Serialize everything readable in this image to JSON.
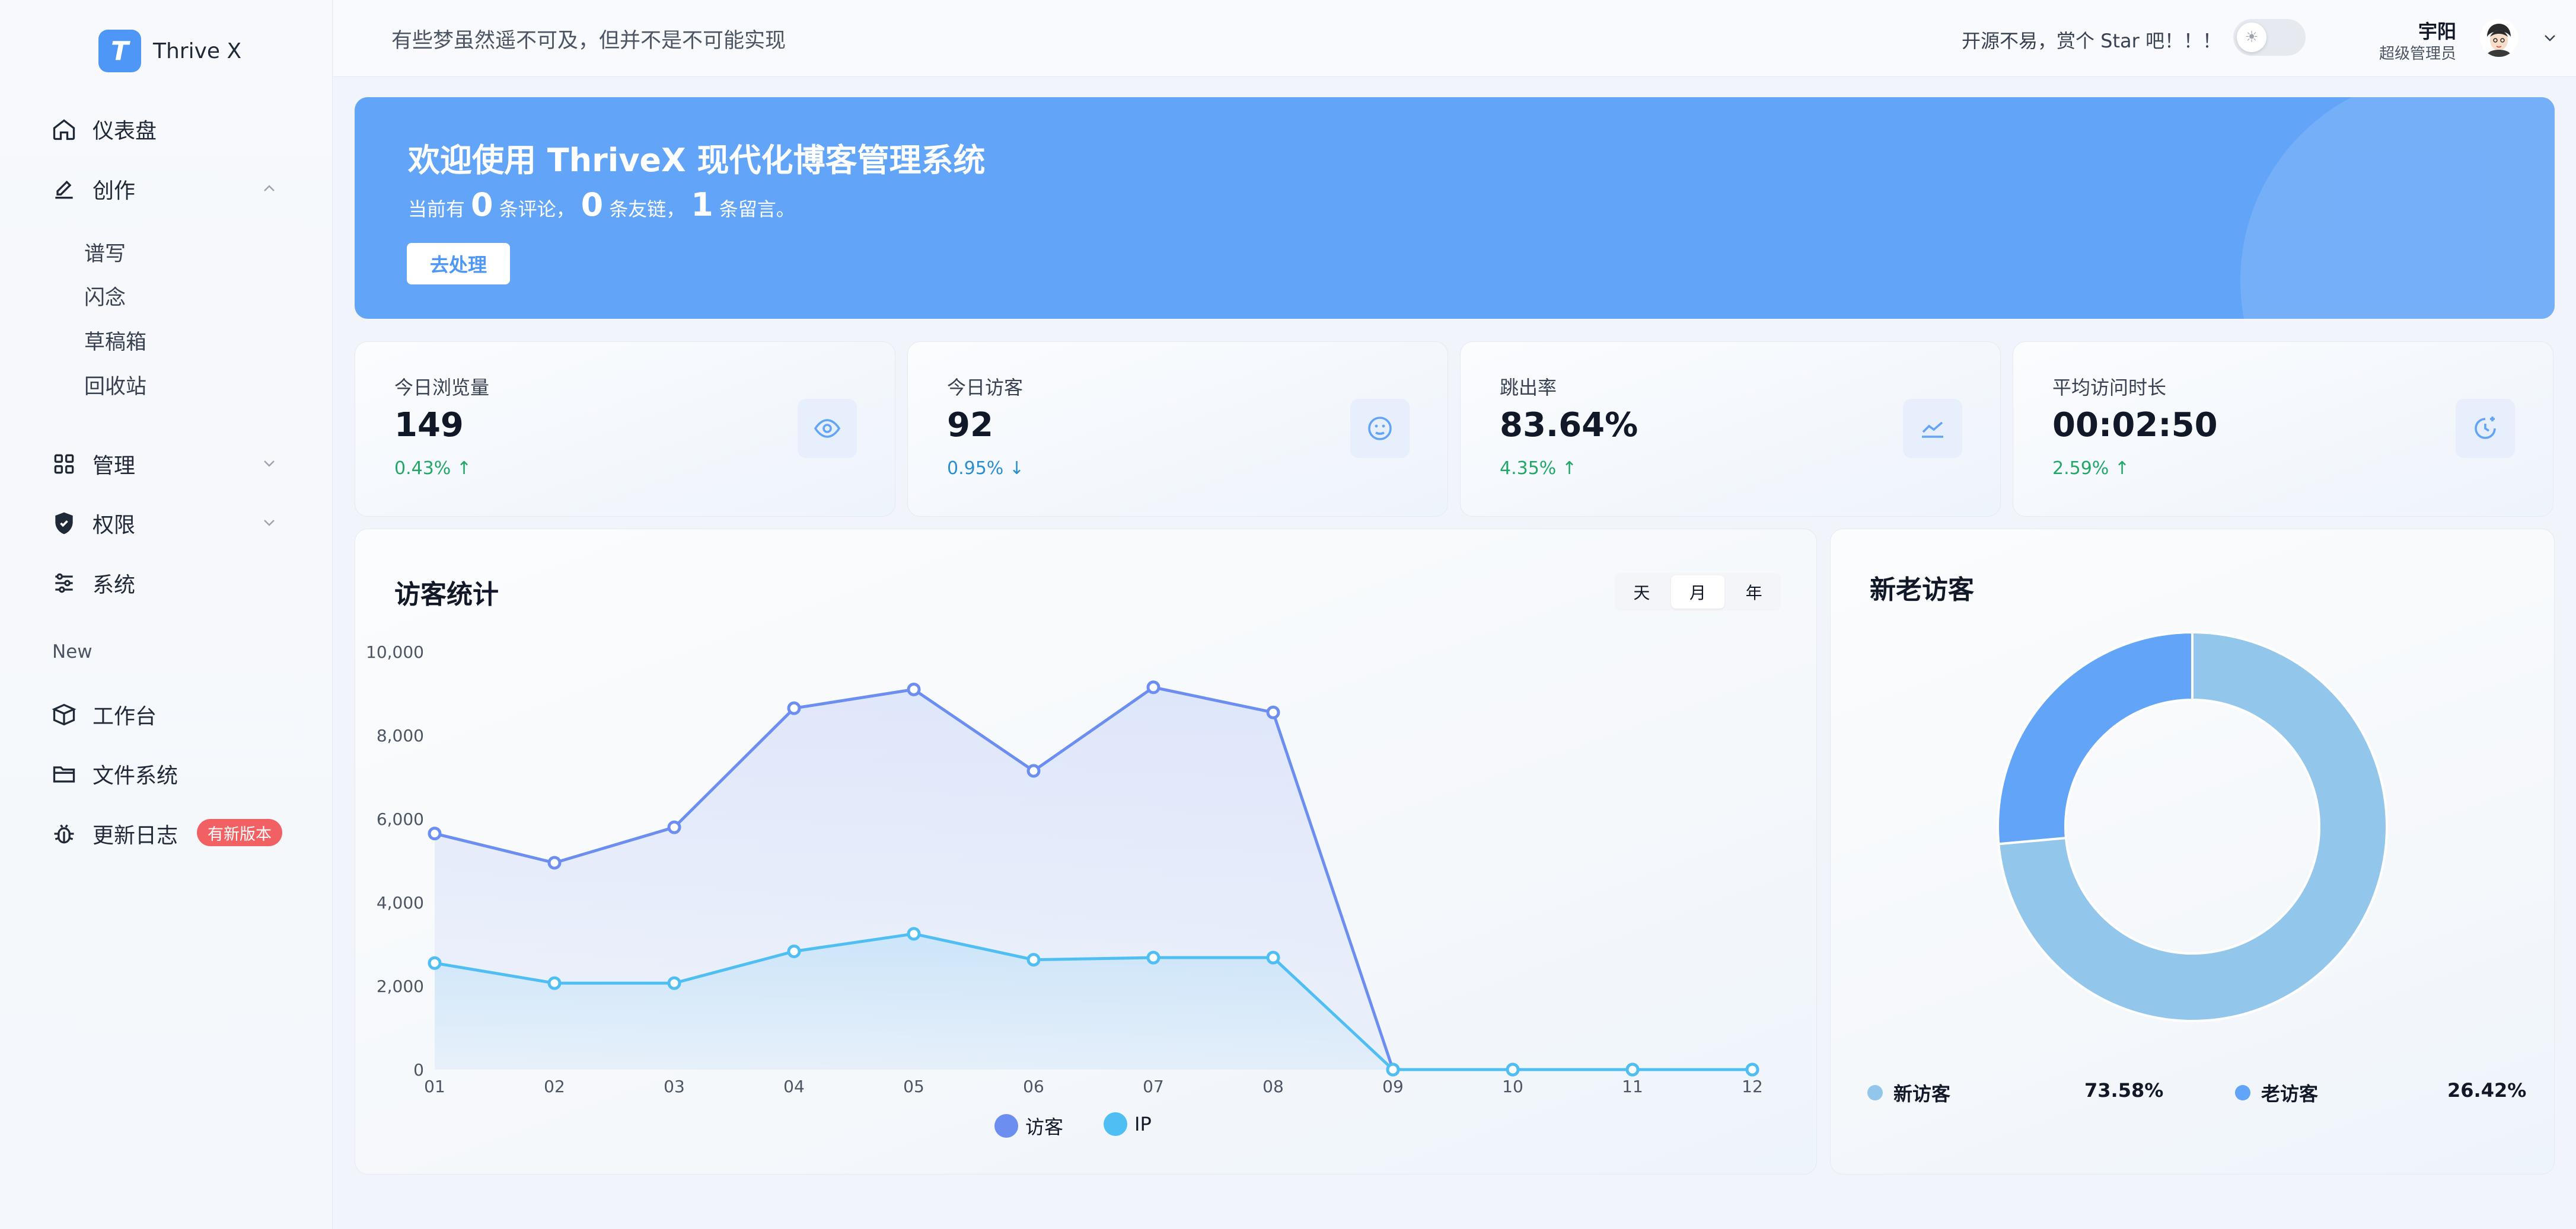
{
  "app": {
    "logo_letter": "T",
    "name": "Thrive X"
  },
  "sidebar": {
    "dashboard": "仪表盘",
    "create": "创作",
    "create_items": [
      "谱写",
      "闪念",
      "草稿箱",
      "回收站"
    ],
    "manage": "管理",
    "permission": "权限",
    "system": "系统",
    "section_new": "New",
    "workbench": "工作台",
    "filesystem": "文件系统",
    "changelog": "更新日志",
    "changelog_badge": "有新版本"
  },
  "header": {
    "motto": "有些梦虽然遥不可及，但并不是不可能实现",
    "star_text": "开源不易，赏个 Star 吧！！！",
    "theme_icon": "sun-icon",
    "user_name": "宇阳",
    "user_role": "超级管理员"
  },
  "banner": {
    "title": "欢迎使用 ThriveX 现代化博客管理系统",
    "prefix": "当前有",
    "comments": "0",
    "comments_label": "条评论，",
    "links": "0",
    "links_label": "条友链，",
    "messages": "1",
    "messages_label": "条留言。",
    "button": "去处理"
  },
  "stats": [
    {
      "label": "今日浏览量",
      "value": "149",
      "change": "0.43% ↑",
      "trend": "up",
      "icon": "eye-icon"
    },
    {
      "label": "今日访客",
      "value": "92",
      "change": "0.95% ↓",
      "trend": "down",
      "icon": "smile-icon"
    },
    {
      "label": "跳出率",
      "value": "83.64%",
      "change": "4.35% ↑",
      "trend": "up",
      "icon": "line-chart-icon"
    },
    {
      "label": "平均访问时长",
      "value": "00:02:50",
      "change": "2.59% ↑",
      "trend": "up",
      "icon": "clock-icon"
    }
  ],
  "visitor_panel": {
    "title": "访客统计",
    "ranges": [
      "天",
      "月",
      "年"
    ],
    "active_range": "月"
  },
  "ratio_panel": {
    "title": "新老访客"
  },
  "colors": {
    "visitors": "#6c8ef0",
    "ip": "#4fbef3",
    "new": "#93c6eb",
    "old": "#62a4f8",
    "accent": "#4e97f6"
  },
  "chart_data": [
    {
      "type": "line",
      "title": "访客统计",
      "x": [
        "01",
        "02",
        "03",
        "04",
        "05",
        "06",
        "07",
        "08",
        "09",
        "10",
        "11",
        "12"
      ],
      "series": [
        {
          "name": "访客",
          "values": [
            5650,
            4950,
            5800,
            8650,
            9100,
            7150,
            9150,
            8550,
            0,
            0,
            0,
            0
          ]
        },
        {
          "name": "IP",
          "values": [
            2550,
            2070,
            2070,
            2830,
            3250,
            2630,
            2680,
            2680,
            0,
            0,
            0,
            0
          ]
        }
      ],
      "ylim": [
        0,
        10000
      ],
      "yticks": [
        "10,000",
        "8,000",
        "6,000",
        "4,000",
        "2,000",
        "0"
      ],
      "legend": "bottom",
      "grid": false
    },
    {
      "type": "pie",
      "title": "新老访客",
      "series": [
        {
          "name": "新访客",
          "value": 73.58,
          "label": "73.58%"
        },
        {
          "name": "老访客",
          "value": 26.42,
          "label": "26.42%"
        }
      ],
      "legend": "bottom"
    }
  ]
}
